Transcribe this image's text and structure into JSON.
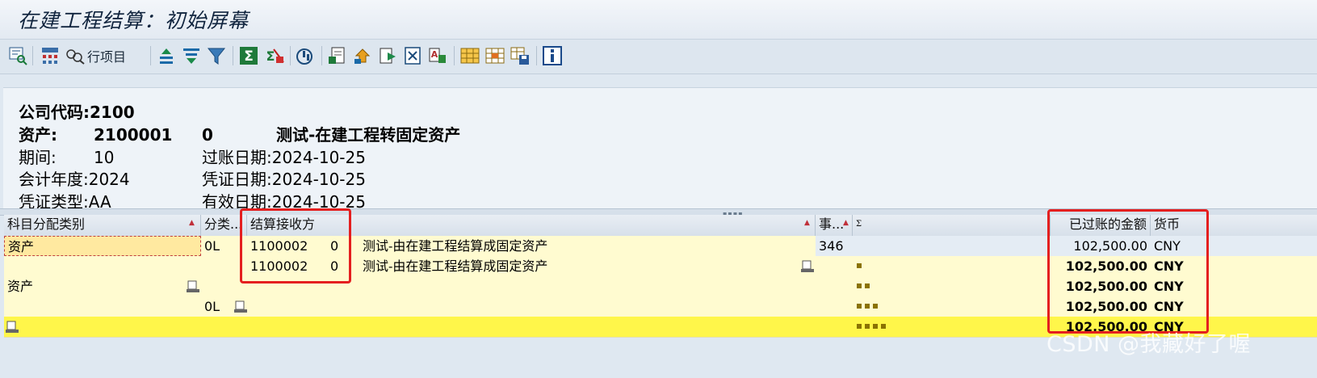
{
  "window": {
    "title": "在建工程结算：初始屏幕"
  },
  "toolbar": {
    "line_items_label": "行项目",
    "icons": [
      "detail-icon",
      "tree-icon",
      "line-items-icon",
      "sort-asc-icon",
      "sort-desc-icon",
      "filter-icon",
      "sum-icon",
      "subtotal-icon",
      "layout-icon",
      "export-icon",
      "excel-icon",
      "word-icon",
      "local-file-icon",
      "mail-icon",
      "grid-icon",
      "choose-layout-icon",
      "save-layout-icon",
      "info-icon"
    ]
  },
  "header": {
    "company_code": "公司代码:2100",
    "asset_label": "资产:",
    "asset_number": "2100001",
    "asset_sub": "0",
    "asset_desc": "测试-在建工程转固定资产",
    "period_label": "期间:",
    "period_value": "10",
    "posting_date": "过账日期:2024-10-25",
    "fiscal_year": "会计年度:2024",
    "document_date": "凭证日期:2024-10-25",
    "doc_type": "凭证类型:AA",
    "value_date": "有效日期:2024-10-25"
  },
  "grid": {
    "columns": {
      "acct_cat": "科目分配类别",
      "category": "分类...",
      "receiver": "结算接收方",
      "event": "事...",
      "sigma": "Σ",
      "amount": "已过账的金额",
      "currency": "货币"
    },
    "rows": [
      {
        "acct_cat": "资产",
        "category": "0L",
        "receiver_id": "1100002",
        "receiver_sub": "0",
        "receiver_desc": "测试-由在建工程结算成固定资产",
        "event": "346",
        "amount": "102,500.00",
        "currency": "CNY"
      },
      {
        "receiver_id": "1100002",
        "receiver_sub": "0",
        "receiver_desc": "测试-由在建工程结算成固定资产",
        "amount": "102,500.00",
        "currency": "CNY"
      },
      {
        "acct_cat": "资产",
        "amount": "102,500.00",
        "currency": "CNY"
      },
      {
        "category": "0L",
        "amount": "102,500.00",
        "currency": "CNY"
      },
      {
        "amount": "102,500.00",
        "currency": "CNY"
      }
    ]
  },
  "colors": {
    "highlight": "#e41f1f",
    "row_yellow": "#fffbd0",
    "total_yellow": "#fff64a"
  },
  "watermark": "CSDN @我藏好了喔"
}
